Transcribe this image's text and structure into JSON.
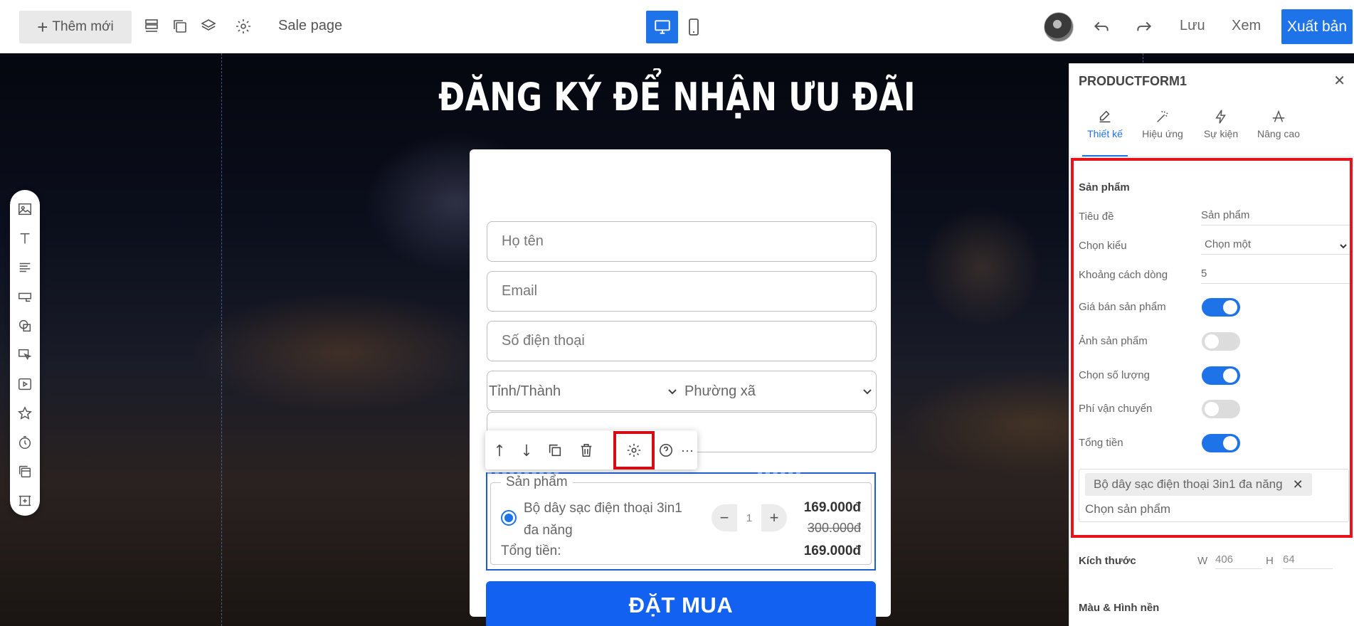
{
  "topbar": {
    "add_label": "Thêm mới",
    "page_name": "Sale page",
    "save_label": "Lưu",
    "preview_label": "Xem",
    "publish_label": "Xuất bản",
    "accent": "#1e73e8"
  },
  "canvas": {
    "headline": "ĐĂNG KÝ ĐỂ NHẬN ƯU ĐÃI",
    "left_toolbar_icons": [
      "image-icon",
      "text-icon",
      "paragraph-icon",
      "button-icon",
      "shape-icon",
      "interactive-icon",
      "video-icon",
      "star-icon",
      "countdown-icon",
      "section-icon",
      "frame-icon"
    ]
  },
  "form": {
    "name_placeholder": "Họ tên",
    "email_placeholder": "Email",
    "phone_placeholder": "Số điện thoại",
    "province_select": "Tỉnh/Thành",
    "ward_select": "Phường xã",
    "product_legend": "Sản phẩm",
    "product_name": "Bộ dây sạc điện thoại 3in1 đa năng",
    "quantity": "1",
    "price": "169.000đ",
    "old_price": "300.000đ",
    "total_label": "Tổng tiền:",
    "total_value": "169.000đ",
    "submit_label": "ĐẶT MUA"
  },
  "panel": {
    "title": "PRODUCTFORM1",
    "tabs": [
      {
        "label": "Thiết kế",
        "icon": "edit-icon",
        "active": true
      },
      {
        "label": "Hiệu ứng",
        "icon": "magic-wand-icon",
        "active": false
      },
      {
        "label": "Sự kiện",
        "icon": "lightning-icon",
        "active": false
      },
      {
        "label": "Nâng cao",
        "icon": "advanced-icon",
        "active": false
      }
    ],
    "section_product": "Sản phẩm",
    "title_label": "Tiêu đề",
    "title_value": "Sản phẩm",
    "type_label": "Chọn kiểu",
    "type_value": "Chọn một",
    "spacing_label": "Khoảng cách dòng",
    "spacing_value": "5",
    "toggles": [
      {
        "label": "Giá bán sản phẩm",
        "on": true
      },
      {
        "label": "Ảnh sản phẩm",
        "on": false
      },
      {
        "label": "Chọn số lượng",
        "on": true
      },
      {
        "label": "Phí vận chuyển",
        "on": false
      },
      {
        "label": "Tổng tiền",
        "on": true
      }
    ],
    "selected_product": "Bộ dây sạc điện thoại 3in1 đa năng",
    "choose_product_placeholder": "Chọn sản phẩm",
    "size_label": "Kích thước",
    "w_label": "W",
    "w_value": "406",
    "h_label": "H",
    "h_value": "64",
    "color_section": "Màu & Hình nền"
  }
}
